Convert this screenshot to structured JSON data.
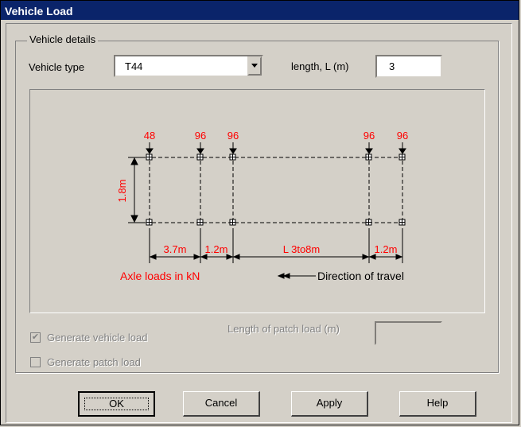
{
  "window": {
    "title": "Vehicle Load"
  },
  "details": {
    "group_label": "Vehicle details",
    "vehicle_type_label": "Vehicle type",
    "vehicle_type_value": "T44",
    "length_label": "length, L (m)",
    "length_value": "3"
  },
  "diagram": {
    "axle_loads": [
      "48",
      "96",
      "96",
      "96",
      "96"
    ],
    "height_label": "1.8m",
    "spacings": [
      "3.7m",
      "1.2m",
      "L 3to8m",
      "1.2m"
    ],
    "axle_caption": "Axle loads in kN",
    "direction_caption": "Direction of travel",
    "colors": {
      "red": "#ff0000",
      "black": "#000000"
    }
  },
  "options": {
    "generate_vehicle_label": "Generate vehicle load",
    "generate_vehicle_checked": true,
    "generate_patch_label": "Generate patch load",
    "generate_patch_checked": false,
    "patch_length_label": "Length of patch load (m)",
    "patch_length_value": ""
  },
  "buttons": {
    "ok": "OK",
    "cancel": "Cancel",
    "apply": "Apply",
    "help": "Help"
  }
}
